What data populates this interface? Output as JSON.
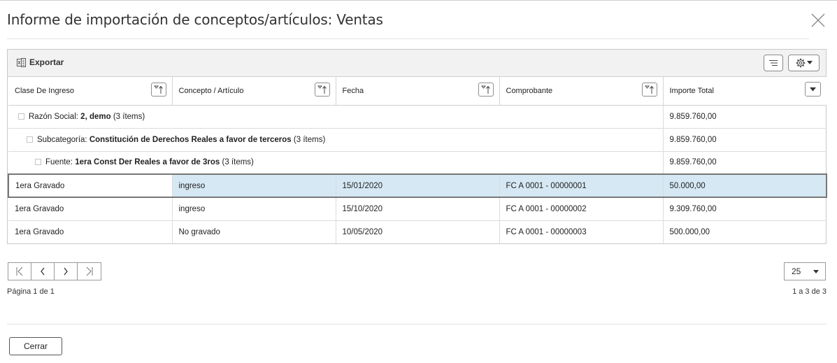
{
  "dialog": {
    "title": "Informe de importación de conceptos/artículos: Ventas",
    "close_icon": "close-icon"
  },
  "toolbar": {
    "export_label": "Exportar",
    "export_icon": "excel-icon",
    "columns_icon": "lines-icon",
    "settings_icon": "gear-icon"
  },
  "columns": [
    {
      "label": "Clase De Ingreso"
    },
    {
      "label": "Concepto / Artículo"
    },
    {
      "label": "Fecha"
    },
    {
      "label": "Comprobante"
    },
    {
      "label": "Importe Total"
    }
  ],
  "groups": [
    {
      "prefix": "Razón Social:",
      "name": "2, demo",
      "count": "(3 ítems)",
      "total": "9.859.760,00"
    },
    {
      "prefix": "Subcategoría:",
      "name": "Constitución de Derechos Reales a favor de terceros",
      "count": "(3 ítems)",
      "total": "9.859.760,00"
    },
    {
      "prefix": "Fuente:",
      "name": "1era Const Der Reales a favor de 3ros",
      "count": "(3 ítems)",
      "total": "9.859.760,00"
    }
  ],
  "rows": [
    {
      "clase": "1era Gravado",
      "concepto": "ingreso",
      "fecha": "15/01/2020",
      "comprobante": "FC A 0001 - 00000001",
      "importe": "50.000,00"
    },
    {
      "clase": "1era Gravado",
      "concepto": "ingreso",
      "fecha": "15/10/2020",
      "comprobante": "FC A 0001 - 00000002",
      "importe": "9.309.760,00"
    },
    {
      "clase": "1era Gravado",
      "concepto": "No gravado",
      "fecha": "10/05/2020",
      "comprobante": "FC A 0001 - 00000003",
      "importe": "500.000,00"
    }
  ],
  "pagination": {
    "page_info": "Página 1 de 1",
    "range_info": "1 a 3 de 3",
    "page_size": "25"
  },
  "footer": {
    "close_label": "Cerrar"
  }
}
